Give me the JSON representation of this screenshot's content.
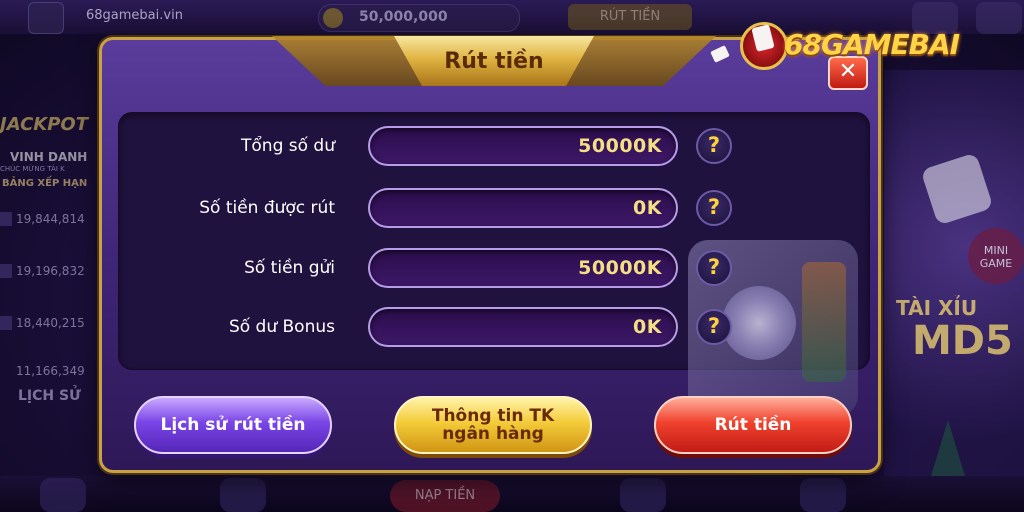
{
  "background": {
    "site": "68gamebai.vin",
    "coins": "50,000,000",
    "top_withdraw": "RÚT TIỀN",
    "jackpot": "JACKPOT",
    "vinh_danh": "VINH DANH",
    "chuc_mung": "CHÚC MỪNG TÀI K",
    "bang_xep_hang": "BẢNG XẾP HẠN",
    "rankings": [
      "19,844,814",
      "19,196,832",
      "18,440,215",
      "11,166,349"
    ],
    "history_tab": "LỊCH SỬ",
    "mini_game": "MINI GAME",
    "tai_xiu": "TÀI XỈU",
    "md5": "MD5",
    "nap_tien": "NẠP TIỀN"
  },
  "logo": {
    "text": "68GAMEBAI"
  },
  "dialog": {
    "title": "Rút tiền",
    "rows": [
      {
        "label": "Tổng số dư",
        "value": "50000K"
      },
      {
        "label": "Số tiền được rút",
        "value": "0K"
      },
      {
        "label": "Số tiền gửi",
        "value": "50000K"
      },
      {
        "label": "Số dư Bonus",
        "value": "0K"
      }
    ],
    "help_symbol": "?",
    "close_symbol": "✕",
    "buttons": {
      "history": "Lịch sử rút tiền",
      "bank_info_line1": "Thông tin TK",
      "bank_info_line2": "ngân hàng",
      "withdraw": "Rút tiền"
    }
  },
  "colors": {
    "dialog_border": "#c9a245",
    "value_text": "#f5df84",
    "help_symbol": "#ffd33b",
    "history_button": "#7a45e6",
    "bank_button": "#f4cc3a",
    "withdraw_button": "#f0422e"
  }
}
